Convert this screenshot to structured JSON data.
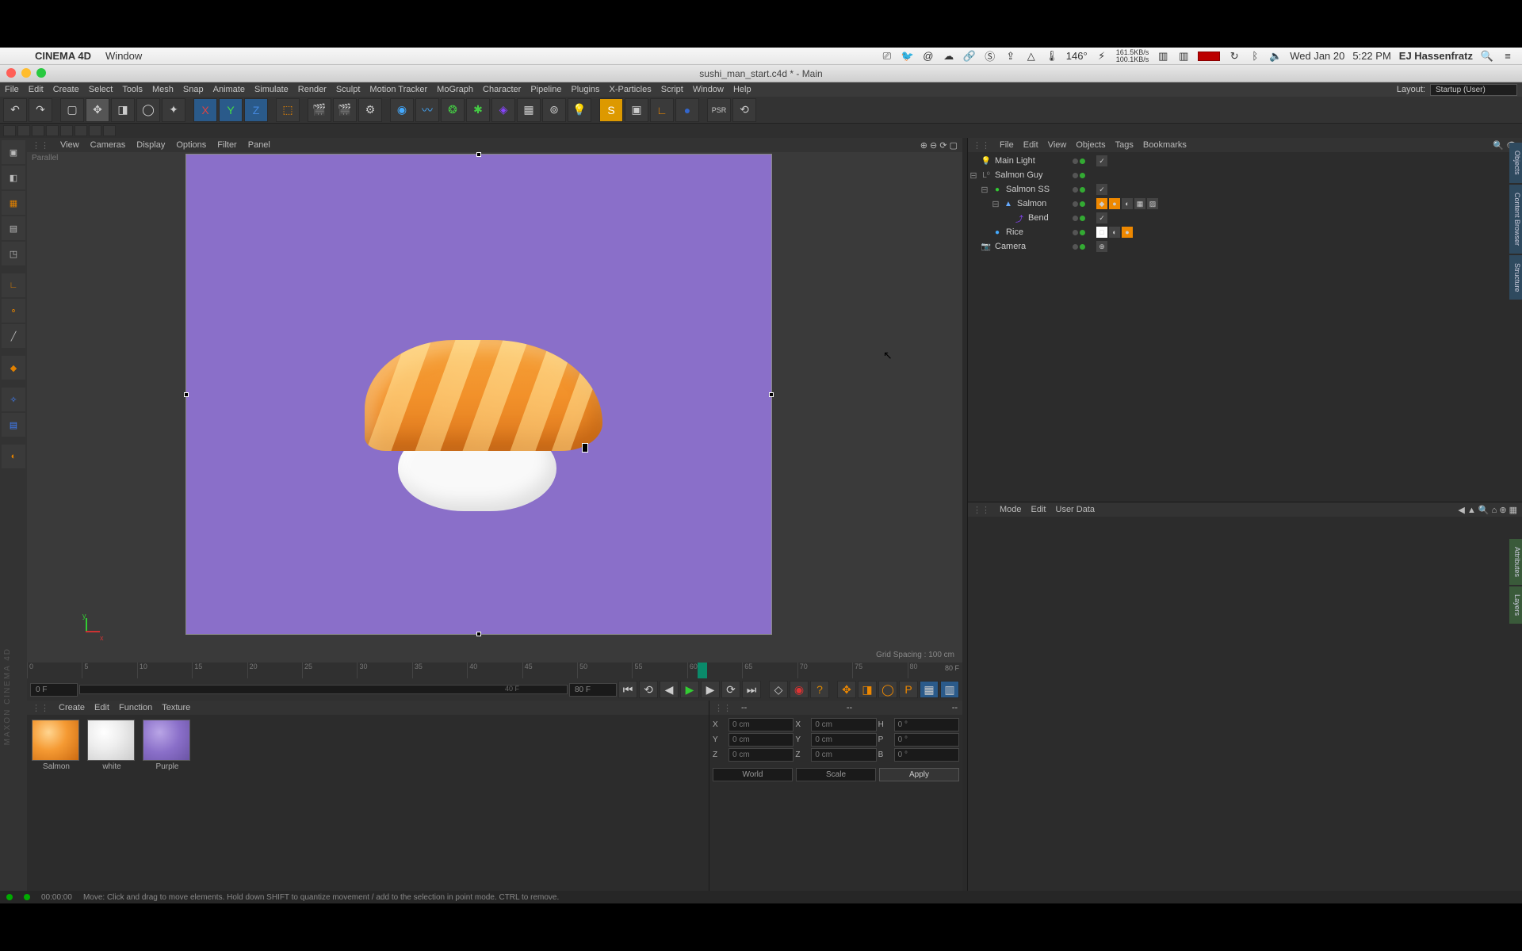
{
  "mac": {
    "app": "CINEMA 4D",
    "menus": [
      "Window"
    ],
    "temp": "146°",
    "netUp": "161.5KB/s",
    "netDown": "100.1KB/s",
    "date": "Wed Jan 20",
    "time": "5:22 PM",
    "user": "EJ Hassenfratz"
  },
  "window": {
    "title": "sushi_man_start.c4d * - Main"
  },
  "c4dMenu": {
    "items": [
      "File",
      "Edit",
      "Create",
      "Select",
      "Tools",
      "Mesh",
      "Snap",
      "Animate",
      "Simulate",
      "Render",
      "Sculpt",
      "Motion Tracker",
      "MoGraph",
      "Character",
      "Pipeline",
      "Plugins",
      "X-Particles",
      "Script",
      "Window",
      "Help"
    ],
    "layoutLabel": "Layout:",
    "layoutValue": "Startup (User)"
  },
  "viewport": {
    "menus": [
      "View",
      "Cameras",
      "Display",
      "Options",
      "Filter",
      "Panel"
    ],
    "projection": "Parallel",
    "gridInfo": "Grid Spacing : 100 cm",
    "axes": {
      "x": "x",
      "y": "y"
    }
  },
  "timeline": {
    "ticks": [
      "0",
      "5",
      "10",
      "15",
      "20",
      "25",
      "30",
      "35",
      "40",
      "45",
      "50",
      "55",
      "60",
      "65",
      "70",
      "75",
      "80"
    ],
    "endLabel": "80 F"
  },
  "playbar": {
    "from": "0 F",
    "mid": "40 F",
    "to": "80 F"
  },
  "materials": {
    "menus": [
      "Create",
      "Edit",
      "Function",
      "Texture"
    ],
    "items": [
      {
        "name": "Salmon",
        "swatch": "sw-salmon"
      },
      {
        "name": "white",
        "swatch": "sw-white"
      },
      {
        "name": "Purple",
        "swatch": "sw-purple"
      }
    ]
  },
  "coord": {
    "labels": {
      "x": "X",
      "y": "Y",
      "z": "Z",
      "h": "H",
      "p": "P",
      "b": "B"
    },
    "posX": "0 cm",
    "posY": "0 cm",
    "posZ": "0 cm",
    "szX": "0 cm",
    "szY": "0 cm",
    "szZ": "0 cm",
    "rotH": "0 °",
    "rotP": "0 °",
    "rotB": "0 °",
    "world": "World",
    "scale": "Scale",
    "apply": "Apply",
    "empty": "--"
  },
  "objMgr": {
    "menus": [
      "File",
      "Edit",
      "View",
      "Objects",
      "Tags",
      "Bookmarks"
    ],
    "tree": [
      {
        "lvl": 0,
        "icon": "💡",
        "name": "Main Light",
        "exp": ""
      },
      {
        "lvl": 0,
        "icon": "◯",
        "name": "Salmon Guy",
        "exp": "-",
        "i": "L0"
      },
      {
        "lvl": 1,
        "icon": "●",
        "name": "Salmon SS",
        "exp": "-"
      },
      {
        "lvl": 2,
        "icon": "▲",
        "name": "Salmon",
        "exp": "-",
        "tags": [
          "◆",
          "●",
          "◐",
          "▦",
          "▨"
        ]
      },
      {
        "lvl": 3,
        "icon": "⤴",
        "name": "Bend",
        "exp": ""
      },
      {
        "lvl": 1,
        "icon": "●",
        "name": "Rice",
        "exp": "",
        "tags": [
          "□",
          "◐",
          "●"
        ]
      },
      {
        "lvl": 0,
        "icon": "📷",
        "name": "Camera",
        "exp": "",
        "tgt": "⊕"
      }
    ]
  },
  "attrMgr": {
    "menus": [
      "Mode",
      "Edit",
      "User Data"
    ]
  },
  "status": {
    "time": "00:00:00",
    "hint": "Move: Click and drag to move elements. Hold down SHIFT to quantize movement / add to the selection in point mode. CTRL to remove."
  },
  "rightTabs": [
    "Objects",
    "Content Browser",
    "Structure",
    "Attributes",
    "Layers"
  ],
  "vlogo": "MAXON CINEMA 4D"
}
